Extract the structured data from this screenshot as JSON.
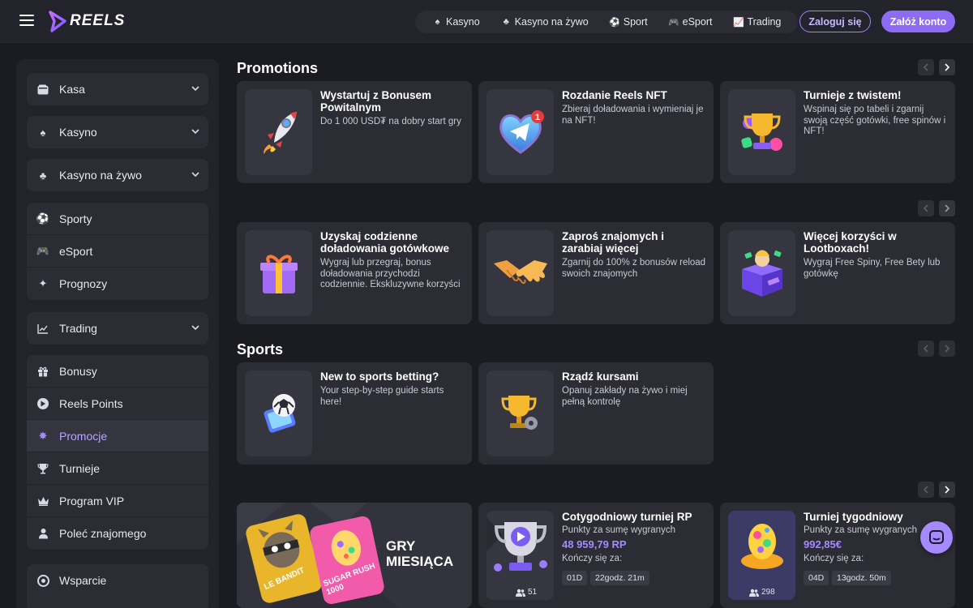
{
  "brand": {
    "name": "REELS",
    "accent": "#8e6bf5"
  },
  "topnav": [
    {
      "label": "Kasyno",
      "icon": "cards-icon"
    },
    {
      "label": "Kasyno na żywo",
      "icon": "dealer-icon"
    },
    {
      "label": "Sport",
      "icon": "soccer-ball-icon"
    },
    {
      "label": "eSport",
      "icon": "gamepad-icon"
    },
    {
      "label": "Trading",
      "icon": "chart-icon"
    }
  ],
  "auth": {
    "login": "Zaloguj się",
    "register": "Załóż konto"
  },
  "sidebar": {
    "kasa": "Kasa",
    "kasyno": "Kasyno",
    "kasyno_live": "Kasyno na żywo",
    "sporty": "Sporty",
    "esport": "eSport",
    "prognozy": "Prognozy",
    "trading": "Trading",
    "bonusy": "Bonusy",
    "reels_points": "Reels Points",
    "promocje": "Promocje",
    "turnieje": "Turnieje",
    "vip": "Program VIP",
    "polec": "Poleć znajomego",
    "wsparcie": "Wsparcie"
  },
  "sections": {
    "promotions": "Promotions",
    "sports": "Sports"
  },
  "promos": [
    {
      "title": "Wystartuj z Bonusem Powitalnym",
      "desc": "Do 1 000 USD₮ na dobry start gry"
    },
    {
      "title": "Rozdanie Reels NFT",
      "desc": "Zbieraj doładowania i wymieniaj je na NFT!"
    },
    {
      "title": "Turnieje z twistem!",
      "desc": "Wspinaj się po tabeli i zgarnij swoją część gotówki, free spinów i NFT!"
    },
    {
      "title": "Uzyskaj codzienne doładowania gotówkowe",
      "desc": "Wygraj lub przegraj, bonus doładowania przychodzi codziennie. Ekskluzywne korzyści"
    },
    {
      "title": "Zaproś znajomych i zarabiaj więcej",
      "desc": "Zgarnij do 100% z bonusów reload swoich znajomych"
    },
    {
      "title": "Więcej korzyści w Lootboxach!",
      "desc": "Wygraj Free Spiny, Free Bety lub gotówkę"
    }
  ],
  "sports_cards": [
    {
      "title": "New to sports betting?",
      "desc": "Your step-by-step guide starts here!"
    },
    {
      "title": "Rządź kursami",
      "desc": "Opanuj zakłady na żywo i miej pełną kontrolę"
    }
  ],
  "feature": {
    "line1": "GRY",
    "line2": "MIESIĄCA",
    "game1": "LE BANDIT",
    "game2": "SUGAR RUSH 1000"
  },
  "tournaments": [
    {
      "title": "Cotygodniowy turniej RP",
      "sub": "Punkty za sumę wygranych",
      "amount": "48 959,79 RP",
      "ends": "Kończy się za:",
      "days": "01D",
      "time": "22godz. 21m",
      "players": "51"
    },
    {
      "title": "Turniej tygodniowy",
      "sub": "Punkty za sumę wygranych",
      "amount": "992,85€",
      "ends": "Kończy się za:",
      "days": "04D",
      "time": "13godz. 50m",
      "players": "298"
    }
  ],
  "nft_badge": "1"
}
